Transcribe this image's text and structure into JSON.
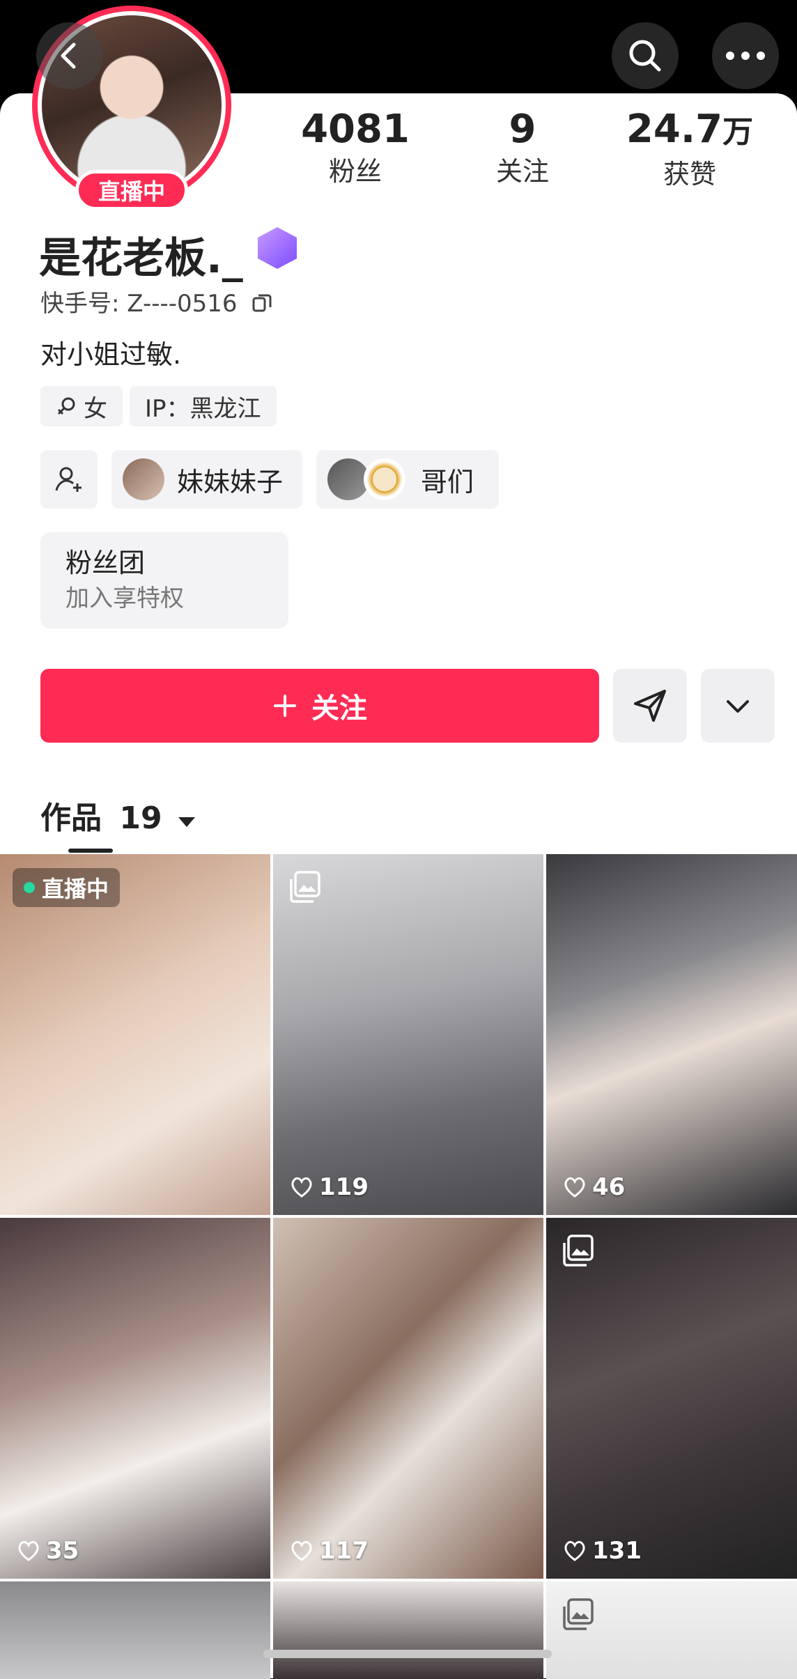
{
  "stats": {
    "fans_num": "4081",
    "fans_label": "粉丝",
    "following_num": "9",
    "following_label": "关注",
    "likes_num": "24.7",
    "likes_unit": "万",
    "likes_label": "获赞"
  },
  "profile": {
    "live_label": "直播中",
    "name": "是花老板._",
    "kid": "快手号: Z----0516",
    "bio": "对小姐过敏.",
    "gender_tag": "女",
    "ip_tag": "IP：黑龙江"
  },
  "relations": [
    {
      "label": "妹妹妹子"
    },
    {
      "label": "哥们"
    }
  ],
  "fanclub": {
    "title": "粉丝团",
    "subtitle": "加入享特权"
  },
  "actions": {
    "follow_label": "关注"
  },
  "works": {
    "label": "作品",
    "count": "19"
  },
  "grid": [
    {
      "live": true,
      "live_label": "直播中",
      "likes": ""
    },
    {
      "likes": "119",
      "images": true
    },
    {
      "likes": "46"
    },
    {
      "likes": "35"
    },
    {
      "likes": "117"
    },
    {
      "likes": "131",
      "images": true
    }
  ],
  "colors": {
    "accent": "#fe2c55",
    "chip_bg": "#f3f3f5"
  },
  "icons": [
    "back-icon",
    "search-icon",
    "more-icon",
    "copy-icon",
    "gender-female-icon",
    "add-friend-icon",
    "share-send-icon",
    "chevron-down-icon",
    "image-set-icon",
    "heart-icon"
  ]
}
